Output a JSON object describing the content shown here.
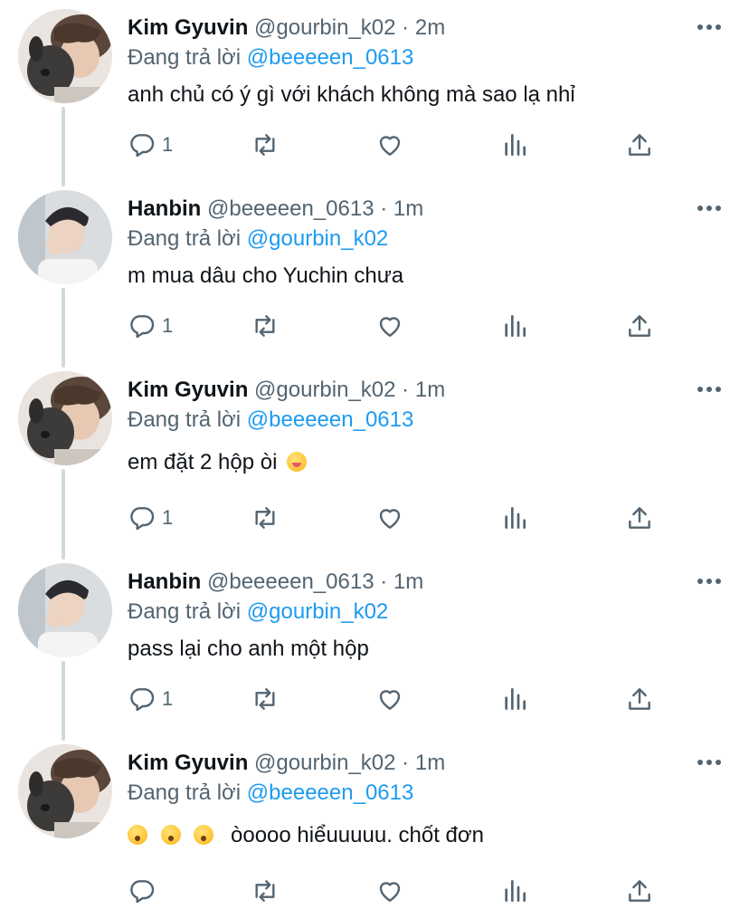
{
  "tweets": [
    {
      "name": "Kim Gyuvin",
      "handle": "@gourbin_k02",
      "dot": "·",
      "time": "2m",
      "reply_prefix": "Đang trả lời",
      "reply_to": "@beeeeen_0613",
      "text": "anh chủ có ý gì với khách không mà sao lạ nhỉ",
      "reply_count": "1",
      "avatar": "avatar-dog"
    },
    {
      "name": "Hanbin",
      "handle": "@beeeeen_0613",
      "dot": "·",
      "time": "1m",
      "reply_prefix": "Đang trả lời",
      "reply_to": "@gourbin_k02",
      "text": "m mua dâu cho Yuchin chưa",
      "reply_count": "1",
      "avatar": "avatar-boy"
    },
    {
      "name": "Kim Gyuvin",
      "handle": "@gourbin_k02",
      "dot": "·",
      "time": "1m",
      "reply_prefix": "Đang trả lời",
      "reply_to": "@beeeeen_0613",
      "text": "em đặt 2 hộp òi",
      "emoji_after": "yum-face-emoji",
      "reply_count": "1",
      "avatar": "avatar-dog"
    },
    {
      "name": "Hanbin",
      "handle": "@beeeeen_0613",
      "dot": "·",
      "time": "1m",
      "reply_prefix": "Đang trả lời",
      "reply_to": "@gourbin_k02",
      "text": "pass lại cho anh một hộp",
      "reply_count": "1",
      "avatar": "avatar-boy"
    },
    {
      "name": "Kim Gyuvin",
      "handle": "@gourbin_k02",
      "dot": "·",
      "time": "1m",
      "reply_prefix": "Đang trả lời",
      "reply_to": "@beeeeen_0613",
      "text": "òoooo hiểuuuuu. chốt đơn",
      "emoji_before": [
        "thinking-face-emoji",
        "astonished-face-emoji",
        "astonished-face-emoji"
      ],
      "reply_count": "",
      "avatar": "avatar-dog"
    }
  ],
  "icons": {
    "reply": "reply-icon",
    "retweet": "retweet-icon",
    "like": "heart-icon",
    "stats": "stats-icon",
    "share": "share-icon",
    "more": "more-icon"
  },
  "colors": {
    "name": "#0f1419",
    "secondary": "#536471",
    "mention": "#1d9bf0",
    "thread_line": "#cfd9de"
  }
}
